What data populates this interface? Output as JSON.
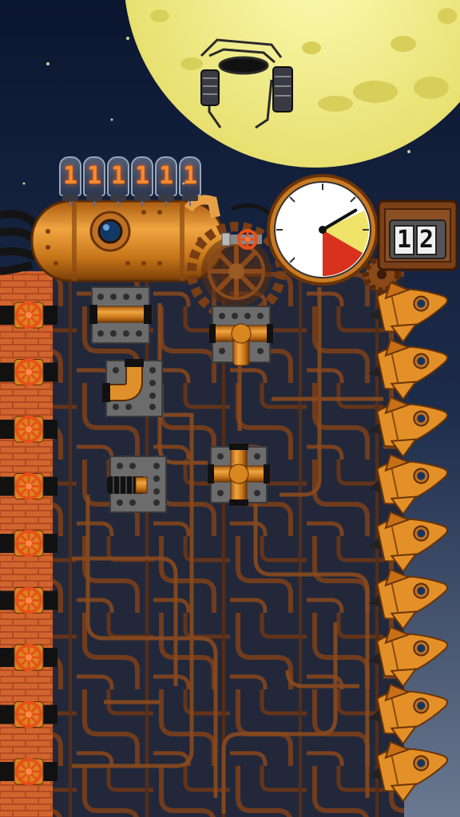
{
  "hud": {
    "score_digits": [
      "1",
      "1",
      "1",
      "1",
      "1",
      "1"
    ],
    "level_digits": [
      "1",
      "2"
    ],
    "gauge": {
      "pressure_fraction": 0.72
    }
  },
  "board": {
    "left_valves": 9,
    "rocket_queue": 9,
    "placed_pieces": [
      "straight-pipe",
      "tee-pipe",
      "elbow-pipe",
      "coupling-pipe",
      "cross-pipe"
    ]
  },
  "colors": {
    "sky": "#0d1a33",
    "moon": "#f3f08a",
    "copper": "#d8861f",
    "brick": "#c75a2a",
    "valve": "#e8501a",
    "gauge_red": "#d8321e",
    "gauge_yellow": "#f0e36a"
  }
}
